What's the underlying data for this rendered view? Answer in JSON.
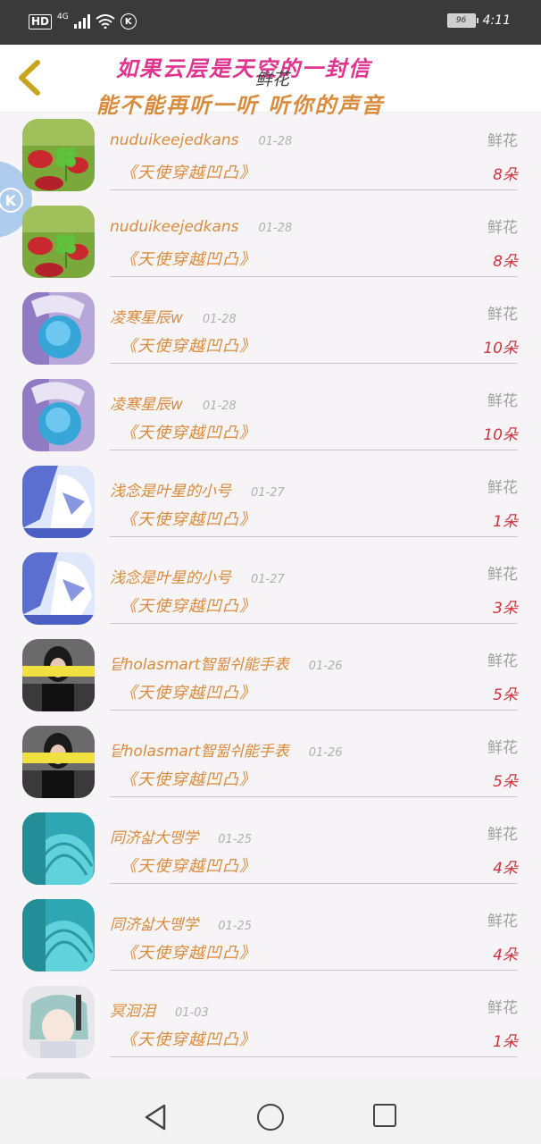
{
  "status": {
    "hd": "HD",
    "network": "4G",
    "battery": "96",
    "time": "4:11"
  },
  "header": {
    "title": "鲜花",
    "lyric_line1": "如果云层是天空的一封信",
    "lyric_line2": "能不能再听一听 听你的声音"
  },
  "colors": {
    "name": "#d98c3e",
    "count": "#d0323e",
    "lyric1": "#e0358f",
    "lyric2": "#d98c3e"
  },
  "rows": [
    {
      "name": "nuduikeejedkans",
      "date": "01-28",
      "gift_type": "鲜花",
      "song": "《天使穿越凹凸》",
      "count": "8朵",
      "avatar": "clover"
    },
    {
      "name": "nuduikeejedkans",
      "date": "01-28",
      "gift_type": "鲜花",
      "song": "《天使穿越凹凸》",
      "count": "8朵",
      "avatar": "clover"
    },
    {
      "name": "凌寒星辰w",
      "date": "01-28",
      "gift_type": "鲜花",
      "song": "《天使穿越凹凸》",
      "count": "10朵",
      "avatar": "anime-blue"
    },
    {
      "name": "凌寒星辰w",
      "date": "01-28",
      "gift_type": "鲜花",
      "song": "《天使穿越凹凸》",
      "count": "10朵",
      "avatar": "anime-blue"
    },
    {
      "name": "浅念是叶星的小号",
      "date": "01-27",
      "gift_type": "鲜花",
      "song": "《天使穿越凹凸》",
      "count": "1朵",
      "avatar": "anime-white"
    },
    {
      "name": "浅念是叶星的小号",
      "date": "01-27",
      "gift_type": "鲜花",
      "song": "《天使穿越凹凸》",
      "count": "3朵",
      "avatar": "anime-white"
    },
    {
      "name": "댵holasmart智뛺쉬能手表",
      "date": "01-26",
      "gift_type": "鲜花",
      "song": "《天使穿越凹凸》",
      "count": "5朵",
      "avatar": "girl-dark"
    },
    {
      "name": "댵holasmart智뛺쉬能手表",
      "date": "01-26",
      "gift_type": "鲜花",
      "song": "《天使穿越凹凸》",
      "count": "5朵",
      "avatar": "girl-dark"
    },
    {
      "name": "同济삷大뗑学",
      "date": "01-25",
      "gift_type": "鲜花",
      "song": "《天使穿越凹凸》",
      "count": "4朵",
      "avatar": "shell-teal"
    },
    {
      "name": "同济삷大뗑学",
      "date": "01-25",
      "gift_type": "鲜花",
      "song": "《天使穿越凹凸》",
      "count": "4朵",
      "avatar": "shell-teal"
    },
    {
      "name": "冥洄泪",
      "date": "01-03",
      "gift_type": "鲜花",
      "song": "《天使穿越凹凸》",
      "count": "1朵",
      "avatar": "anime-grey"
    }
  ]
}
